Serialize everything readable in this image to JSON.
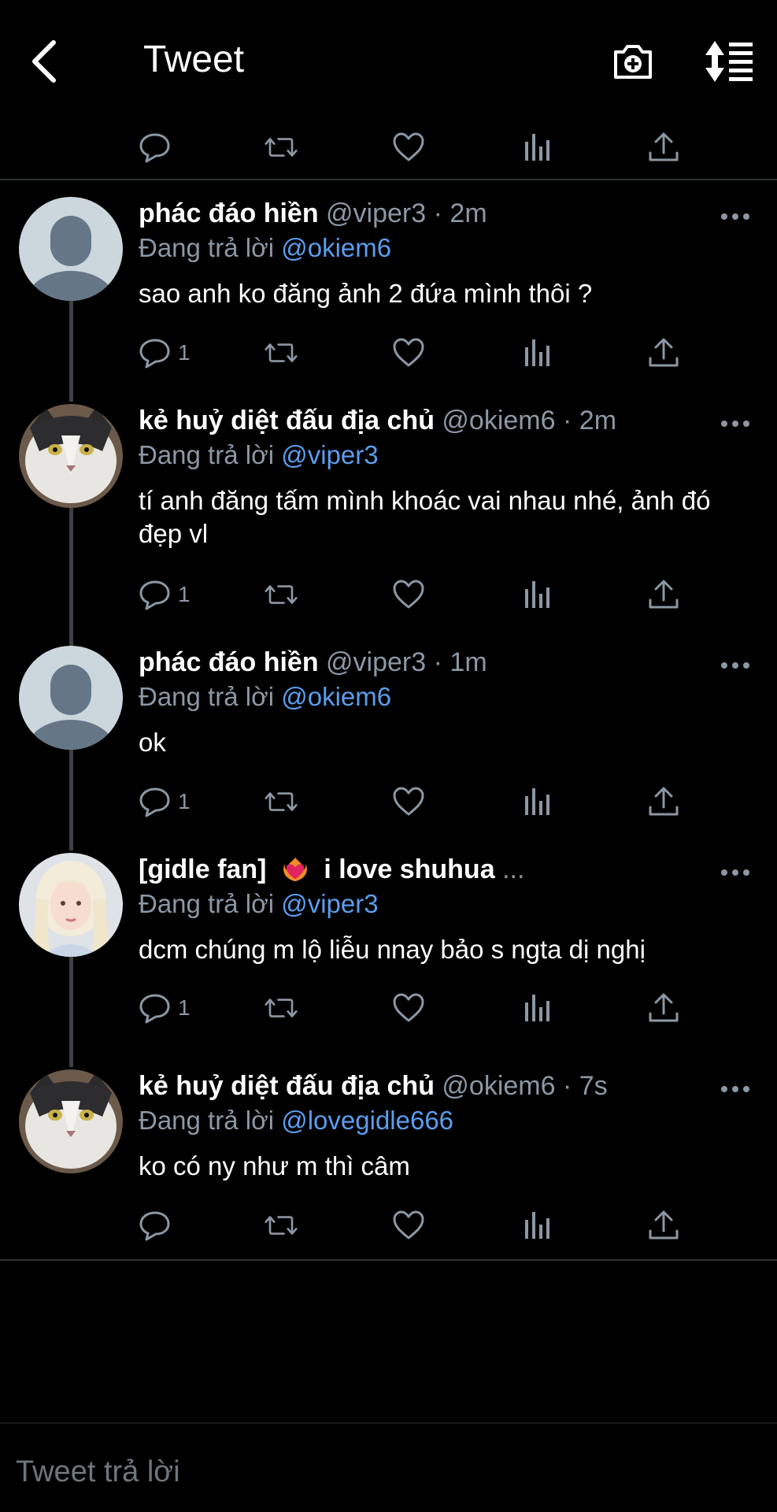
{
  "header": {
    "title": "Tweet",
    "back_icon": "chevron-left-icon",
    "camera_icon": "camera-plus-icon",
    "sort_icon": "sort-icon"
  },
  "tweets": [
    {
      "name": "phác đáo hiền",
      "handle": "@viper3",
      "time": "2m",
      "reply_prefix": "Đang trả lời",
      "mention": "@okiem6",
      "text": "sao anh ko đăng ảnh 2 đứa mình thôi ?",
      "reply_count": "1",
      "avatar": "default"
    },
    {
      "name": "kẻ huỷ diệt đấu địa chủ",
      "handle": "@okiem6",
      "time": "2m",
      "reply_prefix": "Đang trả lời",
      "mention": "@viper3",
      "text": "tí anh đăng tấm mình khoác vai nhau nhé, ảnh đó đẹp vl",
      "reply_count": "1",
      "avatar": "cat"
    },
    {
      "name": "phác đáo hiền",
      "handle": "@viper3",
      "time": "1m",
      "reply_prefix": "Đang trả lời",
      "mention": "@okiem6",
      "text": "ok",
      "reply_count": "1",
      "avatar": "default"
    },
    {
      "name": "[gidle fan]",
      "name_suffix": "i love shuhua",
      "ellipsis": "...",
      "reply_prefix": "Đang trả lời",
      "mention": "@viper3",
      "text": "dcm chúng m lộ liễu nnay bảo s ngta dị nghị",
      "reply_count": "1",
      "avatar": "girl"
    },
    {
      "name": "kẻ huỷ diệt đấu địa chủ",
      "handle": "@okiem6",
      "time": "7s",
      "reply_prefix": "Đang trả lời",
      "mention": "@lovegidle666",
      "text": "ko có ny như m thì câm",
      "reply_count": "",
      "avatar": "cat"
    }
  ],
  "composer": {
    "placeholder": "Tweet trả lời"
  },
  "colors": {
    "background": "#000000",
    "accent": "#5b9ded",
    "muted": "#8b98a5",
    "divider": "#2f3336"
  }
}
